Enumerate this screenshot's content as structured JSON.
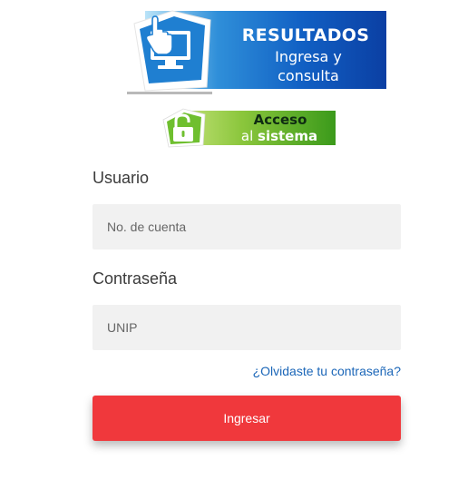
{
  "banner": {
    "title": "RESULTADOS",
    "subtitle_line1": "Ingresa y",
    "subtitle_line2": "consulta",
    "icon": "computer-click-icon"
  },
  "access": {
    "line1": "Acceso",
    "line2_prefix": "al",
    "line2_bold": "sistema",
    "icon": "unlocked-padlock-icon"
  },
  "form": {
    "username_label": "Usuario",
    "username_placeholder": "No. de cuenta",
    "password_label": "Contraseña",
    "password_placeholder": "UNIP",
    "forgot_link": "¿Olvidaste tu contraseña?",
    "submit_label": "Ingresar"
  },
  "colors": {
    "primary_button": "#f0383c",
    "link": "#1b66b8",
    "input_bg": "#f1f1f1",
    "banner_blue": "#1160c4",
    "access_green": "#5fae2a"
  }
}
